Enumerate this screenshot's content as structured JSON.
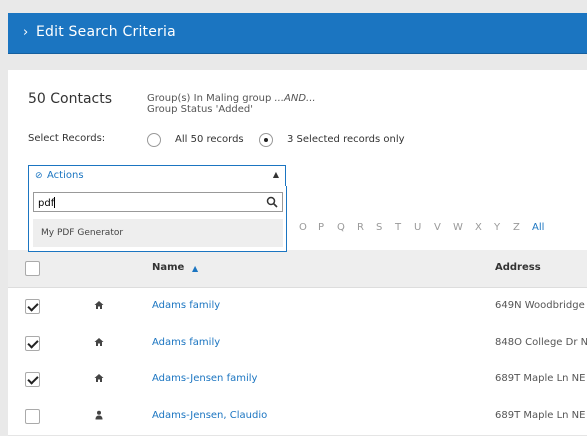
{
  "header": {
    "chevron": "›",
    "title": "Edit Search Criteria"
  },
  "summary": {
    "count": "50 Contacts",
    "criteria_line1_prefix": "Group(s) In Maling group ",
    "criteria_line1_ellipsis": "...AND...",
    "criteria_line2": "Group Status 'Added'"
  },
  "select_records": {
    "label": "Select Records:",
    "options": [
      {
        "label": "All 50 records",
        "selected": false
      },
      {
        "label": "3 Selected records only",
        "selected": true
      }
    ]
  },
  "actions": {
    "icon": "check-circle-icon",
    "label": "Actions",
    "search_value": "pdf",
    "results": [
      "My PDF Generator"
    ]
  },
  "alphabet": [
    "O",
    "P",
    "Q",
    "R",
    "S",
    "T",
    "U",
    "V",
    "W",
    "X",
    "Y",
    "Z",
    "All"
  ],
  "table": {
    "columns": {
      "name": "Name",
      "address": "Address"
    },
    "sort": "ascending",
    "rows": [
      {
        "checked": true,
        "type": "household",
        "name": "Adams family",
        "address": "649N Woodbridge"
      },
      {
        "checked": true,
        "type": "household",
        "name": "Adams family",
        "address": "848O College Dr N"
      },
      {
        "checked": true,
        "type": "household",
        "name": "Adams-Jensen family",
        "address": "689T Maple Ln NE"
      },
      {
        "checked": false,
        "type": "individual",
        "name": "Adams-Jensen, Claudio",
        "address": "689T Maple Ln NE"
      }
    ]
  },
  "colors": {
    "accent": "#1b75c1",
    "header_bg": "#1b75c1"
  }
}
